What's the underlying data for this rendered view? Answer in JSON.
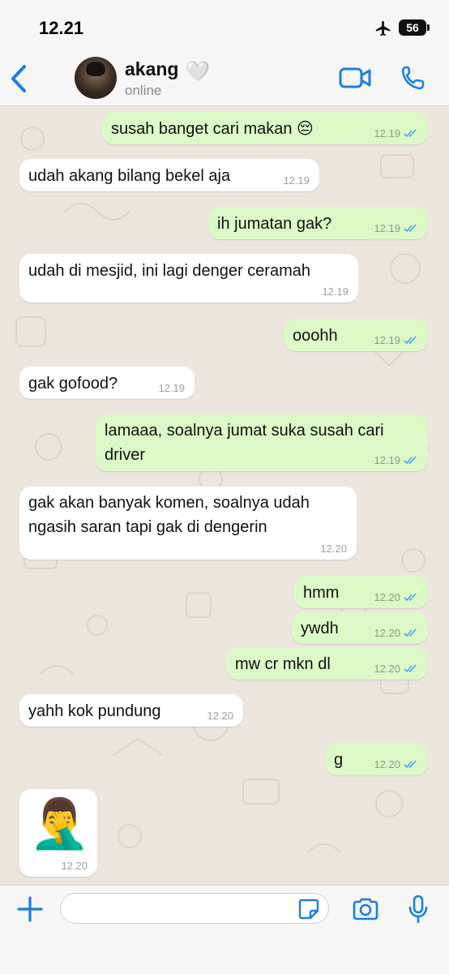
{
  "status_bar": {
    "time": "12.21",
    "battery": "56"
  },
  "header": {
    "name": "akang",
    "heart": "🤍",
    "status": "online"
  },
  "messages": [
    {
      "dir": "out",
      "text": "susah banget cari makan 😔",
      "time": "12.19",
      "read": true
    },
    {
      "dir": "in",
      "text": "udah akang bilang bekel aja",
      "time": "12.19"
    },
    {
      "dir": "out",
      "text": "ih jumatan gak?",
      "time": "12.19",
      "read": true
    },
    {
      "dir": "in",
      "text": "udah di mesjid, ini lagi denger ceramah",
      "time": "12.19"
    },
    {
      "dir": "out",
      "text": "ooohh",
      "time": "12.19",
      "read": true
    },
    {
      "dir": "in",
      "text": "gak gofood?",
      "time": "12.19"
    },
    {
      "dir": "out",
      "text": "lamaaa, soalnya jumat suka susah cari\ndriver",
      "time": "12.19",
      "read": true
    },
    {
      "dir": "in",
      "text": "gak akan banyak komen, soalnya udah\nngasih saran tapi gak di dengerin",
      "time": "12.20"
    },
    {
      "dir": "out",
      "text": "hmm",
      "time": "12.20",
      "read": true
    },
    {
      "dir": "out",
      "text": "ywdh",
      "time": "12.20",
      "read": true
    },
    {
      "dir": "out",
      "text": "mw cr mkn dl",
      "time": "12.20",
      "read": true
    },
    {
      "dir": "in",
      "text": "yahh kok pundung",
      "time": "12.20"
    },
    {
      "dir": "out",
      "text": "g",
      "time": "12.20",
      "read": true
    },
    {
      "dir": "in",
      "sticker": "🤦‍♂️",
      "time": "12.20"
    }
  ],
  "input": {
    "placeholder": ""
  },
  "colors": {
    "accent": "#1a7fe0",
    "outgoing_bubble": "#dcf8c6",
    "incoming_bubble": "#ffffff",
    "read_ticks": "#4fa3e8",
    "chat_bg": "#ece5dd"
  },
  "icons": [
    "back-chevron-icon",
    "video-camera-icon",
    "phone-icon",
    "plus-icon",
    "sticker-icon",
    "camera-icon",
    "microphone-icon",
    "airplane-icon",
    "battery-icon",
    "double-check-icon"
  ]
}
